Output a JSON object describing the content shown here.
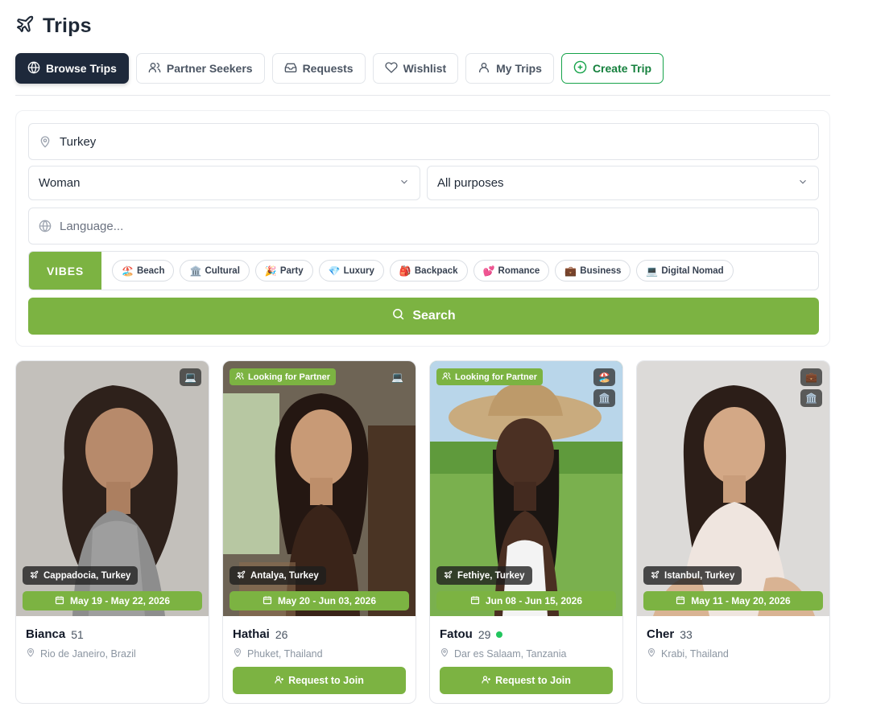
{
  "header": {
    "title": "Trips",
    "icon": "plane-icon"
  },
  "tabs": [
    {
      "label": "Browse Trips",
      "icon": "globe-icon",
      "active": true
    },
    {
      "label": "Partner Seekers",
      "icon": "users-icon"
    },
    {
      "label": "Requests",
      "icon": "inbox-icon"
    },
    {
      "label": "Wishlist",
      "icon": "heart-icon"
    },
    {
      "label": "My Trips",
      "icon": "user-icon"
    },
    {
      "label": "Create Trip",
      "icon": "plus-circle-icon"
    }
  ],
  "search": {
    "destination_value": "Turkey",
    "gender_value": "Woman",
    "purpose_value": "All purposes",
    "language_placeholder": "Language...",
    "vibes_label": "VIBES",
    "vibes": [
      {
        "emoji": "🏖️",
        "label": "Beach"
      },
      {
        "emoji": "🏛️",
        "label": "Cultural"
      },
      {
        "emoji": "🎉",
        "label": "Party"
      },
      {
        "emoji": "💎",
        "label": "Luxury"
      },
      {
        "emoji": "🎒",
        "label": "Backpack"
      },
      {
        "emoji": "💕",
        "label": "Romance"
      },
      {
        "emoji": "💼",
        "label": "Business"
      },
      {
        "emoji": "💻",
        "label": "Digital Nomad"
      }
    ],
    "search_label": "Search"
  },
  "colors": {
    "accent": "#7cb342",
    "dark": "#1e293b",
    "create": "#16a34a",
    "online": "#22c55e"
  },
  "cards": [
    {
      "seeking": "",
      "vibe_icons": [
        "💻"
      ],
      "location": "Cappadocia, Turkey",
      "dates": "May 19 - May 22, 2026",
      "name": "Bianca",
      "age": "51",
      "online": false,
      "home": "Rio de Janeiro, Brazil",
      "join_label": ""
    },
    {
      "seeking": "Looking for Partner",
      "vibe_icons": [
        "💻"
      ],
      "location": "Antalya, Turkey",
      "dates": "May 20 - Jun 03, 2026",
      "name": "Hathai",
      "age": "26",
      "online": false,
      "home": "Phuket, Thailand",
      "join_label": "Request to Join"
    },
    {
      "seeking": "Looking for Partner",
      "vibe_icons": [
        "🏖️",
        "🏛️"
      ],
      "location": "Fethiye, Turkey",
      "dates": "Jun 08 - Jun 15, 2026",
      "name": "Fatou",
      "age": "29",
      "online": true,
      "home": "Dar es Salaam, Tanzania",
      "join_label": "Request to Join"
    },
    {
      "seeking": "",
      "vibe_icons": [
        "💼",
        "🏛️"
      ],
      "location": "Istanbul, Turkey",
      "dates": "May 11 - May 20, 2026",
      "name": "Cher",
      "age": "33",
      "online": false,
      "home": "Krabi, Thailand",
      "join_label": ""
    }
  ]
}
